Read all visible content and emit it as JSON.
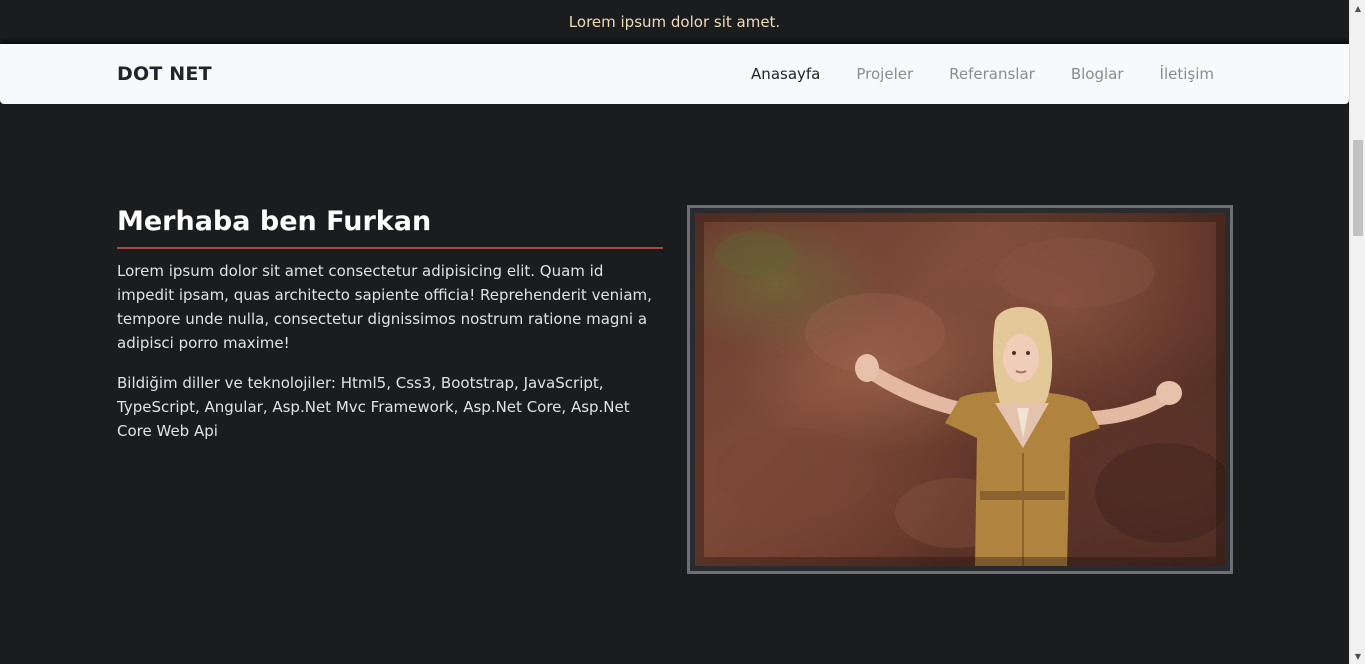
{
  "topbar": {
    "text": "Lorem ipsum dolor sit amet."
  },
  "navbar": {
    "brand": "DOT NET",
    "items": [
      {
        "label": "Anasayfa",
        "active": true
      },
      {
        "label": "Projeler",
        "active": false
      },
      {
        "label": "Referanslar",
        "active": false
      },
      {
        "label": "Bloglar",
        "active": false
      },
      {
        "label": "İletişim",
        "active": false
      }
    ]
  },
  "hero": {
    "title": "Merhaba ben Furkan",
    "paragraph1": "Lorem ipsum dolor sit amet consectetur adipisicing elit. Quam id impedit ipsam, quas architecto sapiente officia! Reprehenderit veniam, tempore unde nulla, consectetur dignissimos nostrum ratione magni a adipisci porro maxime!",
    "paragraph2": "Bildiğim diller ve teknolojiler: Html5, Css3, Bootstrap, JavaScript, TypeScript, Angular, Asp.Net Mvc Framework, Asp.Net Core, Asp.Net Core Web Api",
    "photo_icon": "portrait-photo"
  },
  "colors": {
    "background": "#1b1c1e",
    "topbar_text": "#ecdbb7",
    "navbar_bg": "#f8f9fa",
    "accent_rule": "#a8453d"
  }
}
